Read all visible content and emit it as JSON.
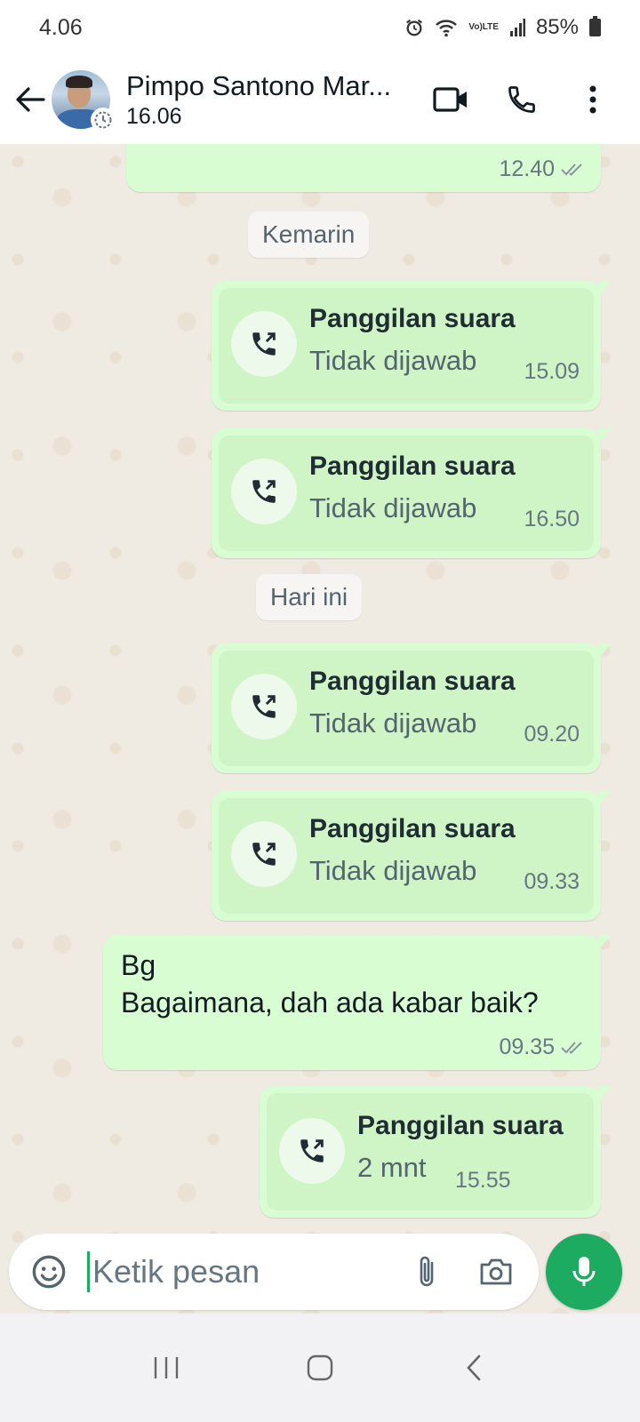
{
  "status_bar": {
    "time": "4.06",
    "battery": "85%",
    "lte_label": "LTE",
    "volte_label": "Vo)"
  },
  "header": {
    "contact_name": "Pimpo Santono Mar...",
    "contact_status": "16.06"
  },
  "chat": {
    "earlier_message_time": "12.40",
    "date_chips": [
      "Kemarin",
      "Hari ini"
    ],
    "calls": [
      {
        "title": "Panggilan suara",
        "subtitle": "Tidak dijawab",
        "time": "15.09"
      },
      {
        "title": "Panggilan suara",
        "subtitle": "Tidak dijawab",
        "time": "16.50"
      },
      {
        "title": "Panggilan suara",
        "subtitle": "Tidak dijawab",
        "time": "09.20"
      },
      {
        "title": "Panggilan suara",
        "subtitle": "Tidak dijawab",
        "time": "09.33"
      }
    ],
    "text_message": {
      "lines": [
        "Bg",
        "Bagaimana, dah ada kabar baik?"
      ],
      "time": "09.35"
    },
    "last_call": {
      "title": "Panggilan suara",
      "subtitle": "2 mnt",
      "time": "15.55"
    }
  },
  "input": {
    "placeholder": "Ketik pesan"
  },
  "colors": {
    "outgoing_bubble": "#d9fdd3",
    "call_inner": "#cff5c7",
    "chat_background": "#efeae2",
    "accent_green": "#1daa61"
  },
  "icons": {
    "back": "arrow-left-icon",
    "video": "video-camera-icon",
    "phone": "phone-icon",
    "menu": "more-vertical-icon",
    "call": "outgoing-call-icon",
    "emoji": "smiley-icon",
    "attach": "paperclip-icon",
    "camera": "camera-icon",
    "mic": "microphone-icon"
  }
}
